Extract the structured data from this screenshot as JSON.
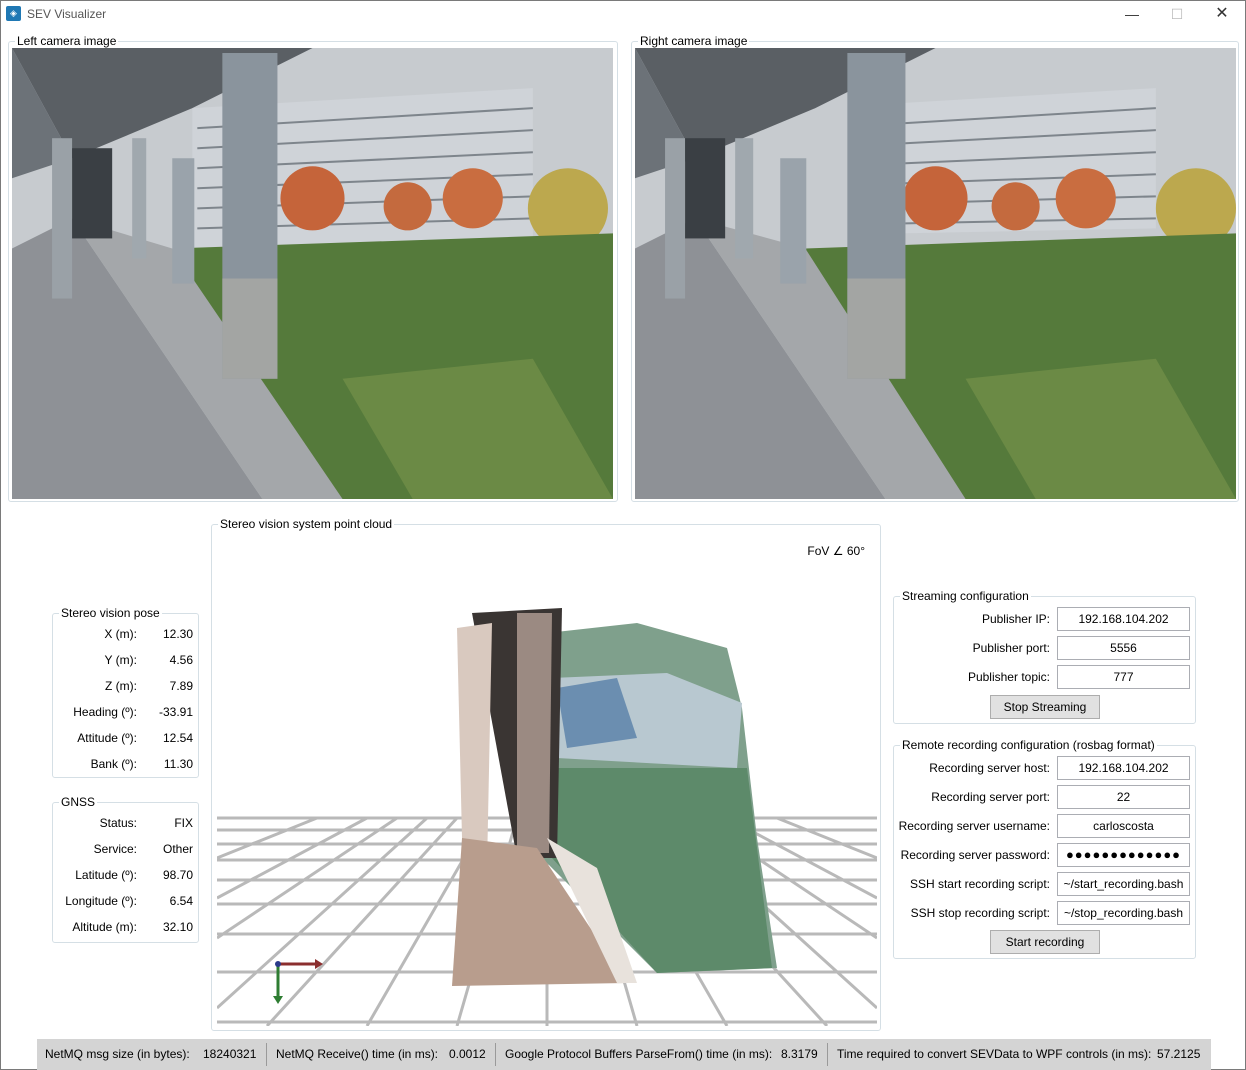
{
  "window": {
    "title": "SEV Visualizer",
    "minimize_glyph": "—",
    "maximize_glyph": "☐",
    "close_glyph": "✕"
  },
  "left_camera": {
    "title": "Left camera image"
  },
  "right_camera": {
    "title": "Right camera image"
  },
  "point_cloud": {
    "title": "Stereo vision system point cloud",
    "fov": "FoV ∠ 60°"
  },
  "stereo_pose": {
    "title": "Stereo vision pose",
    "rows": [
      {
        "label": "X (m):",
        "value": "12.30"
      },
      {
        "label": "Y (m):",
        "value": "4.56"
      },
      {
        "label": "Z (m):",
        "value": "7.89"
      },
      {
        "label": "Heading (º):",
        "value": "-33.91"
      },
      {
        "label": "Attitude (º):",
        "value": "12.54"
      },
      {
        "label": "Bank (º):",
        "value": "11.30"
      }
    ]
  },
  "gnss": {
    "title": "GNSS",
    "rows": [
      {
        "label": "Status:",
        "value": "FIX"
      },
      {
        "label": "Service:",
        "value": "Other"
      },
      {
        "label": "Latitude (º):",
        "value": "98.70"
      },
      {
        "label": "Longitude (º):",
        "value": "6.54"
      },
      {
        "label": "Altitude (m):",
        "value": "32.10"
      }
    ]
  },
  "streaming": {
    "title": "Streaming configuration",
    "ip_label": "Publisher IP:",
    "ip_value": "192.168.104.202",
    "port_label": "Publisher port:",
    "port_value": "5556",
    "topic_label": "Publisher topic:",
    "topic_value": "777",
    "button": "Stop Streaming"
  },
  "recording": {
    "title": "Remote recording configuration (rosbag format)",
    "host_label": "Recording server host:",
    "host_value": "192.168.104.202",
    "port_label": "Recording server port:",
    "port_value": "22",
    "user_label": "Recording server username:",
    "user_value": "carloscosta",
    "pass_label": "Recording server password:",
    "pass_value": "●●●●●●●●●●●●●",
    "start_label": "SSH start recording script:",
    "start_value": "~/start_recording.bash",
    "stop_label": "SSH stop recording script:",
    "stop_value": "~/stop_recording.bash",
    "button": "Start recording"
  },
  "status": {
    "msg_size_label": "NetMQ msg size (in bytes):",
    "msg_size_value": "18240321",
    "receive_label": "NetMQ Receive() time (in ms):",
    "receive_value": "0.0012",
    "parse_label": "Google Protocol Buffers ParseFrom() time (in ms):",
    "parse_value": "8.3179",
    "convert_label": "Time required to convert SEVData to WPF controls (in ms):",
    "convert_value": "57.2125"
  },
  "colors": {
    "accent": "#1f78b4",
    "statusbar": "#d4d4d4",
    "group_border": "#d5dfe5"
  }
}
